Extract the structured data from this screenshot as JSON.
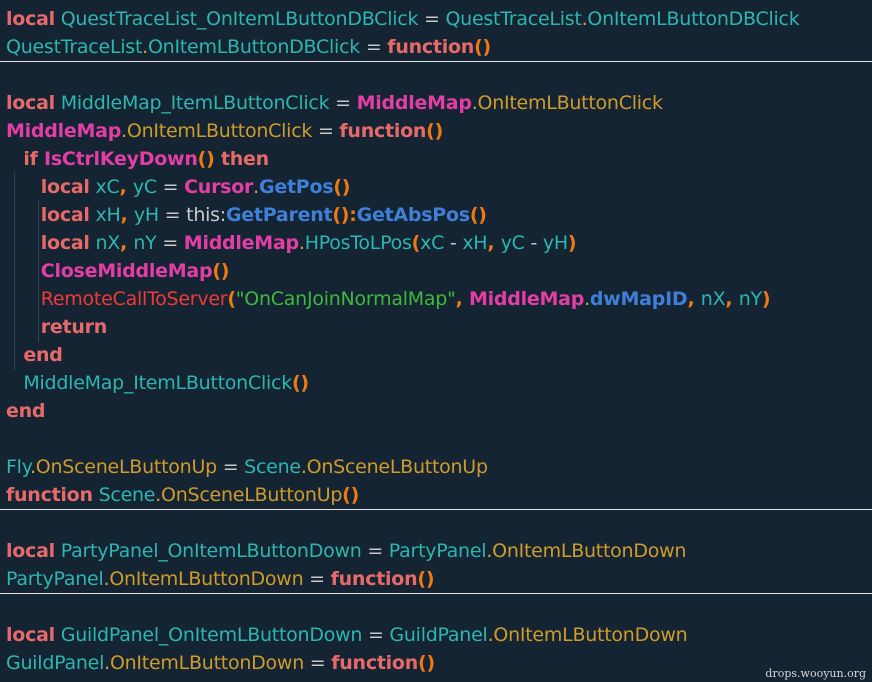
{
  "colors": {
    "background": "#142432",
    "keyword": "#e76a6a",
    "identifier": "#2db6b0",
    "dot": "#e0a43a",
    "method": "#cf9b2c",
    "operator": "#c9c9c9",
    "punct": "#f07a12",
    "module": "#e23ea4",
    "api_call": "#3f7fd8",
    "string": "#3fb840",
    "error_call": "#f03a3a",
    "separator": "#e4e4e4"
  },
  "lines": [
    [
      [
        "kw",
        "local"
      ],
      [
        "sp",
        " "
      ],
      [
        "id",
        "QuestTraceList_OnItemLButtonDBClick"
      ],
      [
        "op",
        " = "
      ],
      [
        "id",
        "QuestTraceList"
      ],
      [
        "dot",
        "."
      ],
      [
        "id",
        "OnItemLButtonDBClick"
      ]
    ],
    [
      [
        "id",
        "QuestTraceList"
      ],
      [
        "dot",
        "."
      ],
      [
        "id",
        "OnItemLButtonDBClick"
      ],
      [
        "op",
        " = "
      ],
      [
        "kw",
        "function"
      ],
      [
        "punct",
        "()"
      ]
    ],
    [],
    [
      [
        "kw",
        "local"
      ],
      [
        "sp",
        " "
      ],
      [
        "id",
        "MiddleMap_ItemLButtonClick"
      ],
      [
        "op",
        " = "
      ],
      [
        "mod",
        "MiddleMap"
      ],
      [
        "dot",
        "."
      ],
      [
        "mth",
        "OnItemLButtonClick"
      ]
    ],
    [
      [
        "mod",
        "MiddleMap"
      ],
      [
        "dot",
        "."
      ],
      [
        "mth",
        "OnItemLButtonClick"
      ],
      [
        "op",
        " = "
      ],
      [
        "kw",
        "function"
      ],
      [
        "punct",
        "()"
      ]
    ],
    [
      [
        "sp",
        "   "
      ],
      [
        "kw",
        "if "
      ],
      [
        "mod",
        "IsCtrlKeyDown"
      ],
      [
        "punct",
        "()"
      ],
      [
        "kw",
        " then"
      ]
    ],
    [
      [
        "sp",
        "      "
      ],
      [
        "kw",
        "local"
      ],
      [
        "sp",
        " "
      ],
      [
        "id",
        "xC"
      ],
      [
        "punct",
        ", "
      ],
      [
        "id",
        "yC"
      ],
      [
        "op",
        " = "
      ],
      [
        "mod",
        "Cursor"
      ],
      [
        "dot",
        "."
      ],
      [
        "api",
        "GetPos"
      ],
      [
        "punct",
        "()"
      ]
    ],
    [
      [
        "sp",
        "      "
      ],
      [
        "kw",
        "local"
      ],
      [
        "sp",
        " "
      ],
      [
        "id",
        "xH"
      ],
      [
        "punct",
        ", "
      ],
      [
        "id",
        "yH"
      ],
      [
        "op",
        " = this:"
      ],
      [
        "api",
        "GetParent"
      ],
      [
        "punct",
        "():"
      ],
      [
        "api",
        "GetAbsPos"
      ],
      [
        "punct",
        "()"
      ]
    ],
    [
      [
        "sp",
        "      "
      ],
      [
        "kw",
        "local"
      ],
      [
        "sp",
        " "
      ],
      [
        "id",
        "nX"
      ],
      [
        "punct",
        ", "
      ],
      [
        "id",
        "nY"
      ],
      [
        "op",
        " = "
      ],
      [
        "mod",
        "MiddleMap"
      ],
      [
        "dot",
        "."
      ],
      [
        "id",
        "HPosToLPos"
      ],
      [
        "punct",
        "("
      ],
      [
        "id",
        "xC"
      ],
      [
        "op",
        " - "
      ],
      [
        "id",
        "xH"
      ],
      [
        "punct",
        ", "
      ],
      [
        "id",
        "yC"
      ],
      [
        "op",
        " - "
      ],
      [
        "id",
        "yH"
      ],
      [
        "punct",
        ")"
      ]
    ],
    [
      [
        "sp",
        "      "
      ],
      [
        "mod",
        "CloseMiddleMap"
      ],
      [
        "punct",
        "()"
      ]
    ],
    [
      [
        "sp",
        "      "
      ],
      [
        "err",
        "RemoteCallToServer"
      ],
      [
        "punct",
        "("
      ],
      [
        "str",
        "\"OnCanJoinNormalMap\""
      ],
      [
        "punct",
        ", "
      ],
      [
        "mod",
        "MiddleMap"
      ],
      [
        "dot",
        "."
      ],
      [
        "api",
        "dwMapID"
      ],
      [
        "punct",
        ", "
      ],
      [
        "id",
        "nX"
      ],
      [
        "punct",
        ", "
      ],
      [
        "id",
        "nY"
      ],
      [
        "punct",
        ")"
      ]
    ],
    [
      [
        "sp",
        "      "
      ],
      [
        "kw",
        "return"
      ]
    ],
    [
      [
        "sp",
        "   "
      ],
      [
        "kw",
        "end"
      ]
    ],
    [
      [
        "sp",
        "   "
      ],
      [
        "id",
        "MiddleMap_ItemLButtonClick"
      ],
      [
        "punct",
        "()"
      ]
    ],
    [
      [
        "kw",
        "end"
      ]
    ],
    [],
    [
      [
        "id",
        "Fly"
      ],
      [
        "dot",
        "."
      ],
      [
        "mth",
        "OnSceneLButtonUp"
      ],
      [
        "op",
        " = "
      ],
      [
        "id",
        "Scene"
      ],
      [
        "dot",
        "."
      ],
      [
        "mth",
        "OnSceneLButtonUp"
      ]
    ],
    [
      [
        "kw",
        "function"
      ],
      [
        "sp",
        " "
      ],
      [
        "id",
        "Scene"
      ],
      [
        "dot",
        "."
      ],
      [
        "mth",
        "OnSceneLButtonUp"
      ],
      [
        "punct",
        "()"
      ]
    ],
    [],
    [
      [
        "kw",
        "local"
      ],
      [
        "sp",
        " "
      ],
      [
        "id",
        "PartyPanel_OnItemLButtonDown"
      ],
      [
        "op",
        " = "
      ],
      [
        "id",
        "PartyPanel"
      ],
      [
        "dot",
        "."
      ],
      [
        "mth",
        "OnItemLButtonDown"
      ]
    ],
    [
      [
        "id",
        "PartyPanel"
      ],
      [
        "dot",
        "."
      ],
      [
        "mth",
        "OnItemLButtonDown"
      ],
      [
        "op",
        " = "
      ],
      [
        "kw",
        "function"
      ],
      [
        "punct",
        "()"
      ]
    ],
    [],
    [
      [
        "kw",
        "local"
      ],
      [
        "sp",
        " "
      ],
      [
        "id",
        "GuildPanel_OnItemLButtonDown"
      ],
      [
        "op",
        " = "
      ],
      [
        "id",
        "GuildPanel"
      ],
      [
        "dot",
        "."
      ],
      [
        "mth",
        "OnItemLButtonDown"
      ]
    ],
    [
      [
        "id",
        "GuildPanel"
      ],
      [
        "dot",
        "."
      ],
      [
        "mth",
        "OnItemLButtonDown"
      ],
      [
        "op",
        " = "
      ],
      [
        "kw",
        "function"
      ],
      [
        "punct",
        "()"
      ]
    ]
  ],
  "watermark": "drops.wooyun.org"
}
